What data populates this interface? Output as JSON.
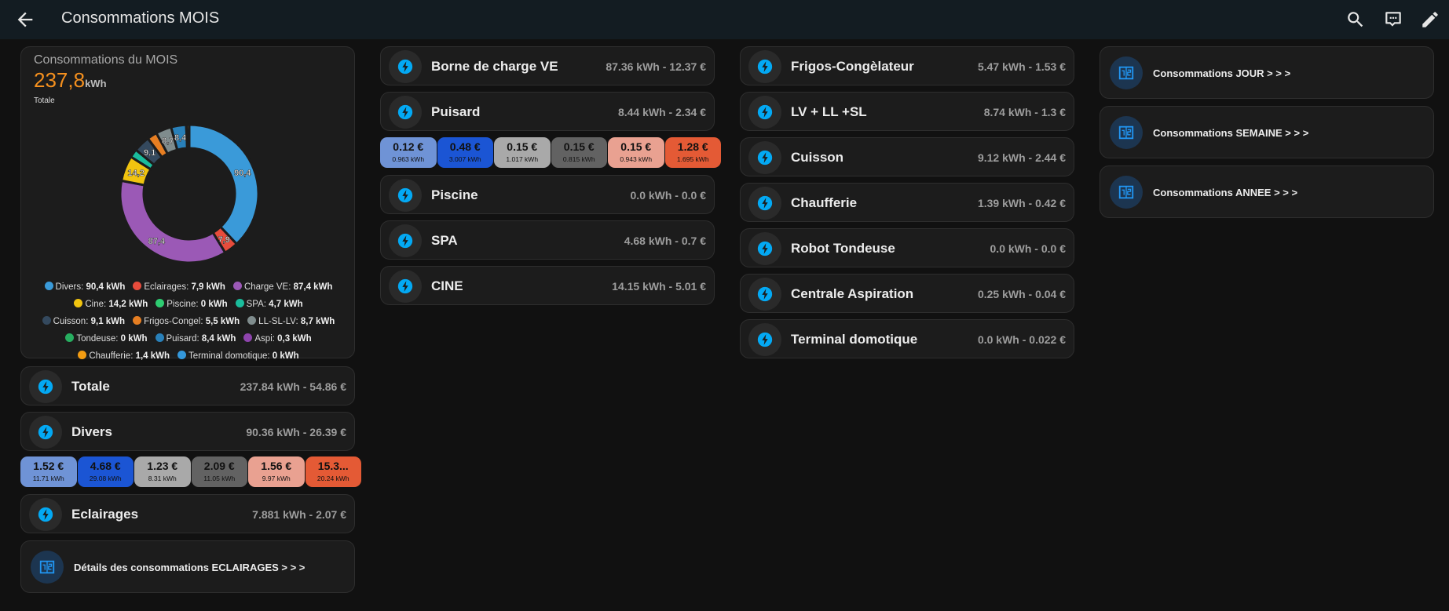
{
  "header": {
    "title": "Consommations MOIS",
    "back_icon": "arrow-left-icon",
    "actions": [
      "search-icon",
      "chat-icon",
      "pencil-icon"
    ]
  },
  "colors": {
    "header_bg": "#131c22",
    "card_bg": "#1c1c1c",
    "accent": "#03a9f4",
    "total": "#f5901e"
  },
  "gauge": {
    "title": "Consommations du MOIS",
    "value": "237,8",
    "unit": "kWh",
    "subtitle": "Totale"
  },
  "chart_data": {
    "type": "pie",
    "donut": true,
    "categories": [
      "Divers",
      "Eclairages",
      "Charge VE",
      "Cine",
      "Piscine",
      "SPA",
      "Cuisson",
      "Frigos-Congel",
      "LL-SL-LV",
      "Tondeuse",
      "Puisard",
      "Aspi",
      "Chaufferie",
      "Terminal domotique"
    ],
    "values": [
      90.4,
      7.9,
      87.4,
      14.2,
      0,
      4.7,
      9.1,
      5.5,
      8.7,
      0,
      8.4,
      0.3,
      1.4,
      0
    ],
    "labels": [
      "90,4",
      "7,9",
      "87,4",
      "14,2",
      "0",
      "4,7",
      "9,1",
      "5,5",
      "8,7",
      "0",
      "8,4",
      "0,3",
      "1,4",
      "0"
    ],
    "legend_values": [
      "90,4 kWh",
      "7,9 kWh",
      "87,4 kWh",
      "14,2 kWh",
      "0 kWh",
      "4,7 kWh",
      "9,1 kWh",
      "5,5 kWh",
      "8,7 kWh",
      "0 kWh",
      "8,4 kWh",
      "0,3 kWh",
      "1,4 kWh",
      "0 kWh"
    ],
    "colors": [
      "#3a9ad9",
      "#e74c3c",
      "#9b59b6",
      "#f1c40f",
      "#2ecc71",
      "#1abc9c",
      "#34495e",
      "#e67e22",
      "#7f8c8d",
      "#27ae60",
      "#2980b9",
      "#8e44ad",
      "#f39c12",
      "#3498db"
    ],
    "legend": "bottom"
  },
  "col1": {
    "totale": {
      "name": "Totale",
      "value": "237.84 kWh - 54.86 €"
    },
    "divers": {
      "name": "Divers",
      "value": "90.36 kWh - 26.39 €"
    },
    "divers_tiles": [
      {
        "price": "1.52 €",
        "kwh": "11.71 kWh"
      },
      {
        "price": "4.68 €",
        "kwh": "29.08 kWh"
      },
      {
        "price": "1.23 €",
        "kwh": "8.31 kWh"
      },
      {
        "price": "2.09 €",
        "kwh": "11.05 kWh"
      },
      {
        "price": "1.56 €",
        "kwh": "9.97 kWh"
      },
      {
        "price": "15.3...",
        "kwh": "20.24 kWh"
      }
    ],
    "eclairages": {
      "name": "Eclairages",
      "value": "7.881 kWh - 2.07 €"
    },
    "details": {
      "label": "Détails des consommations ECLAIRAGES > > >"
    }
  },
  "tile_colors": [
    "#6f93d6",
    "#1b55d4",
    "#a9a9a9",
    "#626262",
    "#e9a191",
    "#e45a35"
  ],
  "col2": {
    "rows": [
      {
        "name": "Borne de charge VE",
        "value": "87.36 kWh - 12.37 €"
      },
      {
        "name": "Puisard",
        "value": "8.44 kWh - 2.34 €"
      },
      {
        "name": "Piscine",
        "value": "0.0 kWh - 0.0 €"
      },
      {
        "name": "SPA",
        "value": "4.68 kWh - 0.7 €"
      },
      {
        "name": "CINE",
        "value": "14.15 kWh - 5.01 €"
      }
    ],
    "puisard_tiles": [
      {
        "price": "0.12 €",
        "kwh": "0.963 kWh"
      },
      {
        "price": "0.48 €",
        "kwh": "3.007 kWh"
      },
      {
        "price": "0.15 €",
        "kwh": "1.017 kWh"
      },
      {
        "price": "0.15 €",
        "kwh": "0.815 kWh"
      },
      {
        "price": "0.15 €",
        "kwh": "0.943 kWh"
      },
      {
        "price": "1.28 €",
        "kwh": "1.695 kWh"
      }
    ]
  },
  "col3": {
    "rows": [
      {
        "name": "Frigos-Congèlateur",
        "value": "5.47 kWh - 1.53 €"
      },
      {
        "name": "LV + LL +SL",
        "value": "8.74 kWh - 1.3 €"
      },
      {
        "name": "Cuisson",
        "value": "9.12 kWh - 2.44 €"
      },
      {
        "name": "Chaufferie",
        "value": "1.39 kWh - 0.42 €"
      },
      {
        "name": "Robot Tondeuse",
        "value": "0.0 kWh - 0.0 €"
      },
      {
        "name": "Centrale Aspiration",
        "value": "0.25 kWh - 0.04 €"
      },
      {
        "name": "Terminal domotique",
        "value": "0.0 kWh - 0.022 €"
      }
    ]
  },
  "col4": {
    "links": [
      {
        "label": "Consommations JOUR > > >"
      },
      {
        "label": "Consommations SEMAINE > > >"
      },
      {
        "label": "Consommations ANNEE > > >"
      }
    ]
  }
}
